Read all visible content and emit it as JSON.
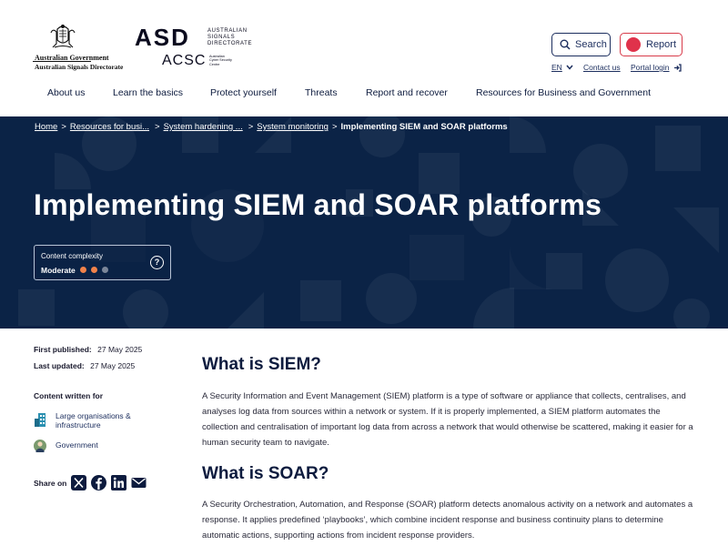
{
  "header": {
    "gov_line1": "Australian Government",
    "gov_line2": "Australian Signals Directorate",
    "asd_big": "ASD",
    "asd_sub": "AUSTRALIAN\nSIGNALS\nDIRECTORATE",
    "acsc_big": "ACSC",
    "acsc_sub": "Australian\nCyber Security\nCentre",
    "search_label": "Search",
    "report_label": "Report",
    "language": "EN",
    "contact_label": "Contact us",
    "login_label": "Portal login"
  },
  "nav": {
    "items": [
      "About us",
      "Learn the basics",
      "Protect yourself",
      "Threats",
      "Report and recover",
      "Resources for Business and Government"
    ]
  },
  "breadcrumb": {
    "home": "Home",
    "b1": "Resources for busi...",
    "b2": "System hardening ...",
    "b3": "System monitoring",
    "current": "Implementing SIEM and SOAR platforms",
    "sep": ">"
  },
  "hero": {
    "title": "Implementing SIEM and SOAR platforms",
    "complexity_label": "Content complexity",
    "complexity_level": "Moderate",
    "complexity_value": 2,
    "complexity_max": 3,
    "help": "?"
  },
  "sidebar": {
    "first_published_label": "First published:",
    "first_published": "27 May 2025",
    "last_updated_label": "Last updated:",
    "last_updated": "27 May 2025",
    "content_written_for": "Content written for",
    "audiences": [
      "Large organisations & infrastructure",
      "Government"
    ],
    "share_label": "Share on",
    "share_icons": [
      "x-icon",
      "facebook-icon",
      "linkedin-icon",
      "email-icon"
    ]
  },
  "content": {
    "siem_heading": "What is SIEM?",
    "siem_para": "A Security Information and Event Management (SIEM) platform is a type of software or appliance that collects, centralises, and analyses log data from sources within a network or system. If it is properly implemented, a SIEM platform automates the collection and centralisation of important log data from across a network that would otherwise be scattered, making it easier for a human security team to navigate.",
    "soar_heading": "What is SOAR?",
    "soar_para": "A Security Orchestration, Automation, and Response (SOAR) platform detects anomalous activity on a network and automates a response. It applies predefined ‘playbooks’, which combine incident response and business continuity plans to determine automatic actions, supporting actions from incident response providers."
  },
  "colors": {
    "navy": "#0b2346",
    "accent_orange": "#f0824a",
    "dot_grey": "#7a8699",
    "report_red": "#e0324b"
  }
}
